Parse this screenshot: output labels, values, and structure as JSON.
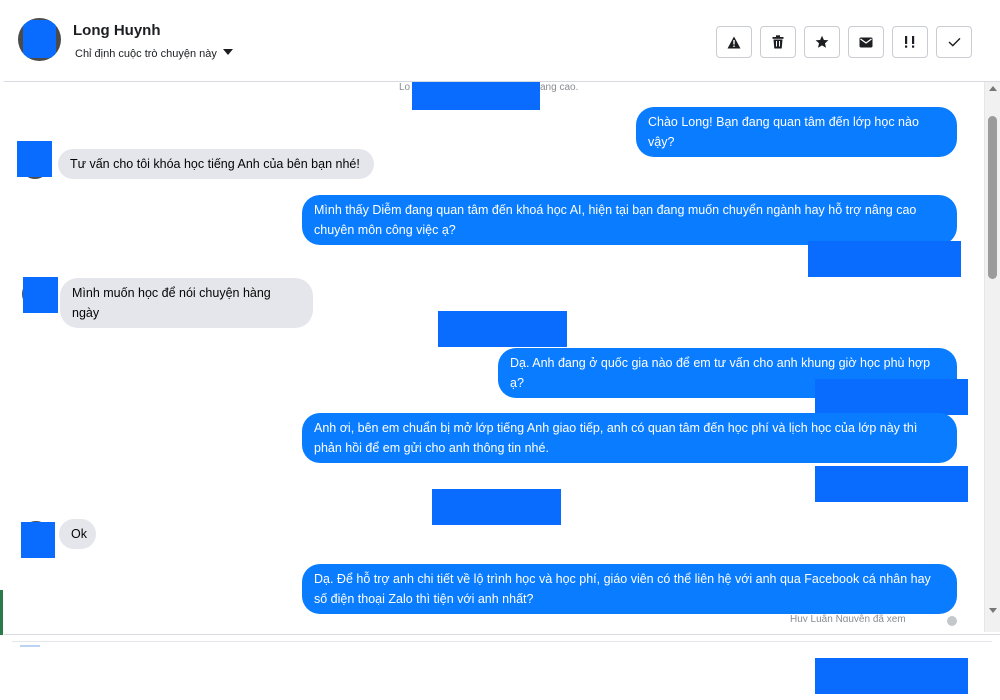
{
  "header": {
    "contact_name": "Long Huynh",
    "assign_label": "Chỉ định cuộc trò chuyện này",
    "actions": [
      {
        "name": "spam-button",
        "icon": "warning-icon"
      },
      {
        "name": "delete-button",
        "icon": "trash-icon"
      },
      {
        "name": "star-button",
        "icon": "star-icon"
      },
      {
        "name": "mark-unread-button",
        "icon": "envelope-icon"
      },
      {
        "name": "follow-up-button",
        "icon": "follow-up-icon"
      },
      {
        "name": "done-button",
        "icon": "check-icon"
      }
    ]
  },
  "conversation": {
    "system_note_left": "Lo",
    "system_note_right": "ang cao.",
    "messages": [
      {
        "from": "page",
        "text": "Chào Long! Bạn đang quan tâm đến lớp học nào vậy?"
      },
      {
        "from": "user",
        "text": "Tư vấn cho tôi khóa học tiếng Anh của bên bạn nhé!"
      },
      {
        "from": "page",
        "text": "Mình thấy Diễm đang quan tâm đến khoá học AI, hiện tại bạn đang muốn chuyển ngành hay hỗ trợ nâng cao chuyên môn công việc ạ?"
      },
      {
        "from": "user",
        "text": "Mình muốn học để nói chuyện hàng ngày"
      },
      {
        "from": "page",
        "text": "Dạ. Anh đang ở quốc gia nào để em tư vấn cho anh khung giờ học phù hợp ạ?"
      },
      {
        "from": "page",
        "text": "Anh ơi, bên em chuẩn bị mở lớp tiếng Anh giao tiếp, anh có quan tâm đến học phí và lịch học của lớp này thì phản hồi để em gửi cho anh thông tin nhé."
      },
      {
        "from": "user",
        "text": "Ok"
      },
      {
        "from": "page",
        "text": "Dạ. Để hỗ trợ anh chi tiết về lộ trình học và học phí, giáo viên có thể liên hệ với anh qua Facebook cá nhân hay số điện thoại Zalo thì tiện với anh nhất?"
      }
    ],
    "trailing_note": "Huy Luân Nguyễn đã xem"
  },
  "colors": {
    "outgoing_bubble": "#0a7cff",
    "incoming_bubble": "#e4e6eb",
    "redaction": "#0a6cff"
  }
}
